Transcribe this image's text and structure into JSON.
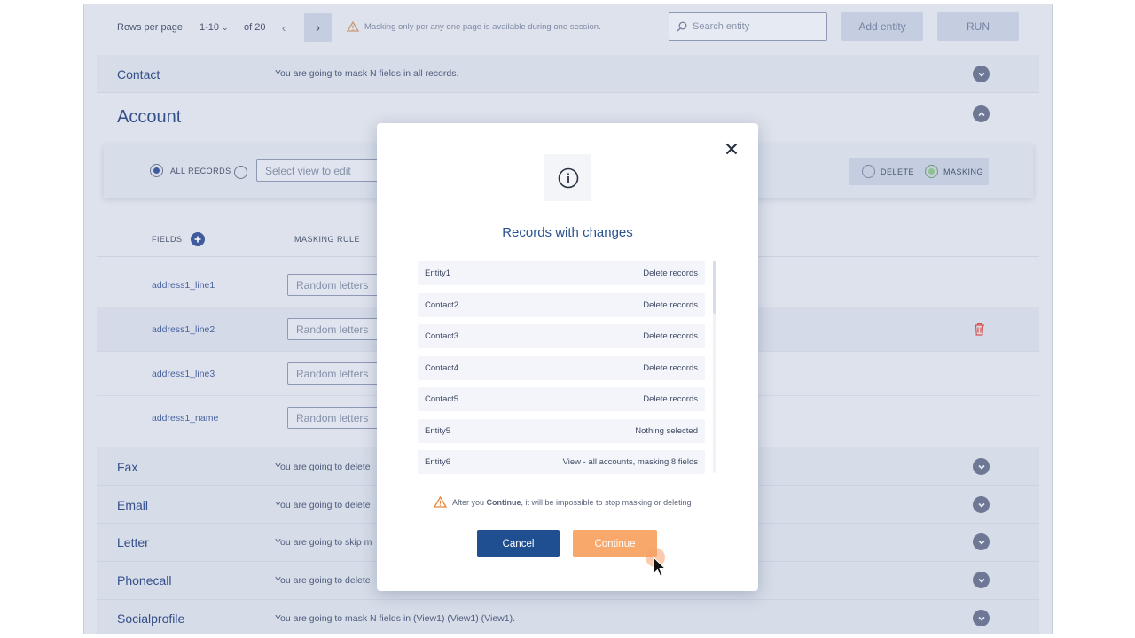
{
  "toolbar": {
    "rows_per_page_label": "Rows per page",
    "rows_range": "1-10",
    "of_pages": "of 20",
    "warning": "Masking only per any one page is available during one session.",
    "search_placeholder": "Search entity",
    "add_entity": "Add entity",
    "run": "RUN"
  },
  "rows": {
    "contact": {
      "title": "Contact",
      "desc": "You are going to mask N fields in all records."
    },
    "account": {
      "title": "Account"
    },
    "fax": {
      "title": "Fax",
      "desc": "You are going to delete"
    },
    "email": {
      "title": "Email",
      "desc": "You are going to delete"
    },
    "letter": {
      "title": "Letter",
      "desc": "You are going to skip m"
    },
    "phonecall": {
      "title": "Phonecall",
      "desc": "You are going to delete"
    },
    "socialprofile": {
      "title": "Socialprofile",
      "desc": "You are going to mask N fields in (View1) (View1) (View1)."
    }
  },
  "account_panel": {
    "all_records": "ALL RECORDS",
    "select_view_placeholder": "Select view to edit",
    "delete": "DELETE",
    "masking": "MASKING",
    "fields_header": "FIELDS",
    "masking_rule_header": "MASKING RULE"
  },
  "fields": [
    {
      "name": "address1_line1",
      "rule": "Random letters"
    },
    {
      "name": "address1_line2",
      "rule": "Random letters"
    },
    {
      "name": "address1_line3",
      "rule": "Random letters"
    },
    {
      "name": "address1_name",
      "rule": "Random letters"
    }
  ],
  "modal": {
    "title": "Records with changes",
    "records": [
      {
        "entity": "Entity1",
        "action": "Delete records"
      },
      {
        "entity": "Contact2",
        "action": "Delete records"
      },
      {
        "entity": "Contact3",
        "action": "Delete records"
      },
      {
        "entity": "Contact4",
        "action": "Delete records"
      },
      {
        "entity": "Contact5",
        "action": "Delete records"
      },
      {
        "entity": "Entity5",
        "action": "Nothing selected"
      },
      {
        "entity": "Entity6",
        "action": "View - all accounts, masking 8 fields"
      }
    ],
    "warning_pre": "After you ",
    "warning_bold": "Continue",
    "warning_post": ", it will be impossible to stop masking or deleting",
    "cancel": "Cancel",
    "continue": "Continue"
  },
  "colors": {
    "accent": "#1f4f91",
    "continue": "#f9a86b",
    "warning_icon": "#e8873c",
    "danger": "#d9534f"
  }
}
